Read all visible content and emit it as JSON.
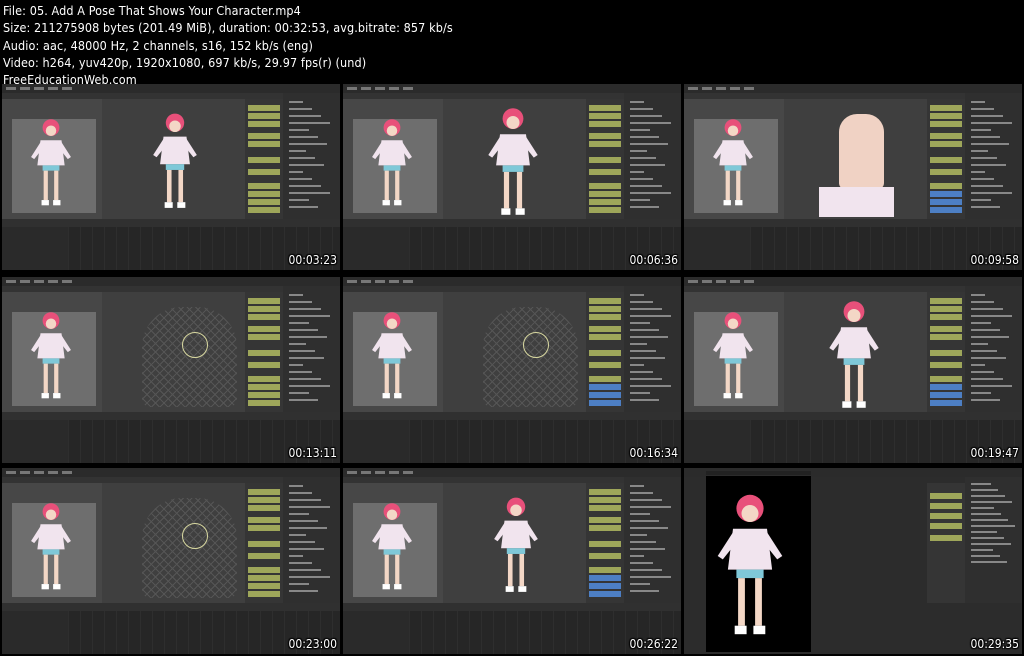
{
  "header": {
    "line1": "File: 05. Add A Pose That Shows Your Character.mp4",
    "line2": "Size: 211275908 bytes (201.49 MiB), duration: 00:32:53, avg.bitrate: 857 kb/s",
    "line3": "Audio: aac, 48000 Hz, 2 channels, s16, 152 kb/s (eng)",
    "line4": "Video: h264, yuv420p, 1920x1080, 697 kb/s, 29.97 fps(r) (und)",
    "line5": "FreeEducationWeb.com"
  },
  "thumbnails": [
    {
      "timestamp": "00:03:23",
      "view": "full-character"
    },
    {
      "timestamp": "00:06:36",
      "view": "arm-raised"
    },
    {
      "timestamp": "00:09:58",
      "view": "hand-closeup"
    },
    {
      "timestamp": "00:13:11",
      "view": "wireframe-bust"
    },
    {
      "timestamp": "00:16:34",
      "view": "wireframe-hand"
    },
    {
      "timestamp": "00:19:47",
      "view": "peace-sign"
    },
    {
      "timestamp": "00:23:00",
      "view": "wireframe-body"
    },
    {
      "timestamp": "00:26:22",
      "view": "full-pose"
    },
    {
      "timestamp": "00:29:35",
      "view": "render-black"
    }
  ],
  "colors": {
    "character_hair": "#e8507a",
    "character_hoodie": "#f1e4ee",
    "props_highlight": "#9ea65a",
    "props_button": "#4d7fc4"
  }
}
